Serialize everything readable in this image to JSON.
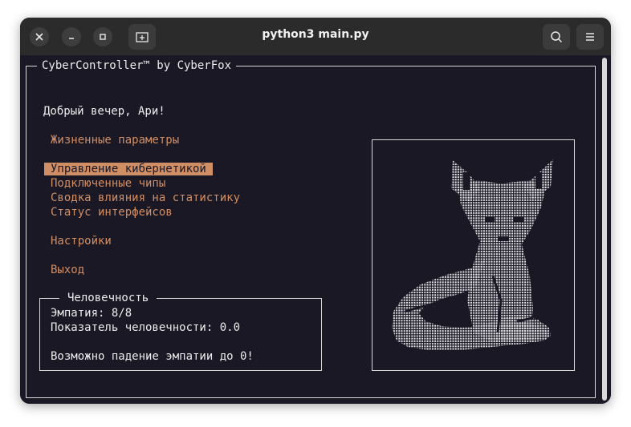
{
  "window": {
    "title": "python3 main.py"
  },
  "app": {
    "frame_title": "CyberController™ by CyberFox",
    "greeting": "Добрый вечер, Ари!",
    "menu": {
      "vitals": "Жизненные параметры",
      "items": [
        "Управление кибернетикой",
        "Подключенные чипы",
        "Сводка влияния на статистику",
        "Статус интерфейсов"
      ],
      "selected_index": 0,
      "settings": "Настройки",
      "exit": "Выход"
    },
    "humanity": {
      "title": "Человечность",
      "empathy": "Эмпатия: 8/8",
      "index": "Показатель человечности: 0.0",
      "warning": "Возможно падение эмпатии до 0!"
    }
  },
  "colors": {
    "terminal_bg": "#1a1825",
    "accent": "#d08e64",
    "text": "#ececec"
  }
}
